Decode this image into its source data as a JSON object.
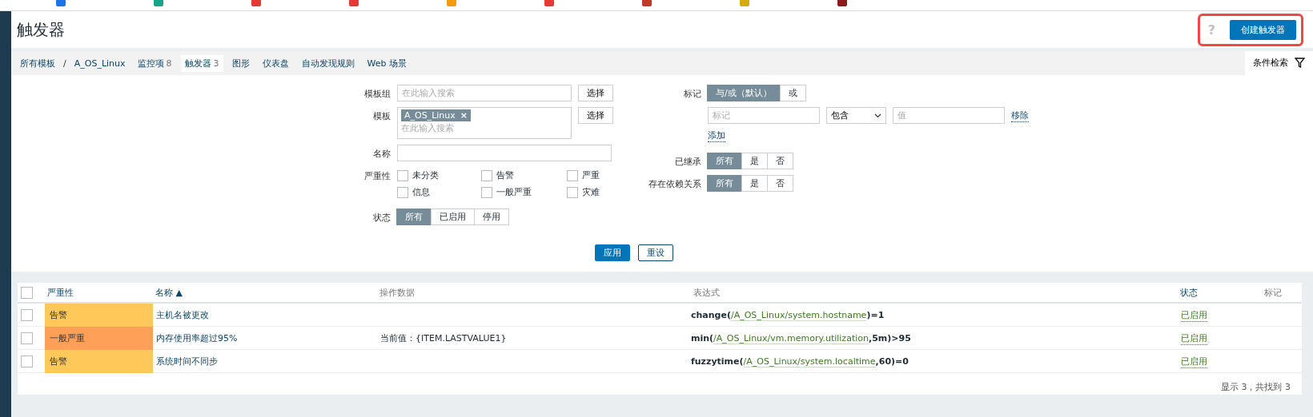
{
  "page_title": "触发器",
  "help": "?",
  "create_button": "创建触发器",
  "breadcrumbs": [
    "所有模板",
    "A_OS_Linux"
  ],
  "breadcrumb_separator": "/",
  "tabs": [
    {
      "label": "监控项",
      "count": "8",
      "selected": false
    },
    {
      "label": "触发器",
      "count": "3",
      "selected": true
    },
    {
      "label": "图形",
      "selected": false
    },
    {
      "label": "仪表盘",
      "selected": false
    },
    {
      "label": "自动发现规则",
      "selected": false
    },
    {
      "label": "Web 场景",
      "selected": false
    }
  ],
  "filter_toggle": "条件检索",
  "filter": {
    "template_group": {
      "label": "模板组",
      "placeholder": "在此输入搜索",
      "button": "选择"
    },
    "template": {
      "label": "模板",
      "chip": "A_OS_Linux",
      "chip_remove": "×",
      "placeholder": "在此输入搜索",
      "button": "选择"
    },
    "name": {
      "label": "名称"
    },
    "severity": {
      "label": "严重性",
      "options": [
        {
          "label": "未分类",
          "checked": false
        },
        {
          "label": "告警",
          "checked": false
        },
        {
          "label": "严重",
          "checked": false
        },
        {
          "label": "信息",
          "checked": false
        },
        {
          "label": "一般严重",
          "checked": false
        },
        {
          "label": "灾难",
          "checked": false
        }
      ]
    },
    "state": {
      "label": "状态",
      "options": [
        {
          "label": "所有",
          "selected": true
        },
        {
          "label": "已启用",
          "selected": false
        },
        {
          "label": "停用",
          "selected": false
        }
      ]
    },
    "tags": {
      "label": "标记",
      "options": [
        {
          "label": "与/或（默认）",
          "selected": true
        },
        {
          "label": "或",
          "selected": false
        }
      ],
      "tag_placeholder": "标记",
      "operator": "包含",
      "value_placeholder": "值",
      "remove": "移除",
      "add": "添加"
    },
    "inherited": {
      "label": "已继承",
      "options": [
        {
          "label": "所有",
          "selected": true
        },
        {
          "label": "是",
          "selected": false
        },
        {
          "label": "否",
          "selected": false
        }
      ]
    },
    "dependencies": {
      "label": "存在依赖关系",
      "options": [
        {
          "label": "所有",
          "selected": true
        },
        {
          "label": "是",
          "selected": false
        },
        {
          "label": "否",
          "selected": false
        }
      ]
    },
    "apply": "应用",
    "reset": "重设"
  },
  "table": {
    "all_checked": false,
    "columns": [
      {
        "label": "严重性",
        "sortable": true
      },
      {
        "label": "名称",
        "sortable": true,
        "sort": "▲"
      },
      {
        "label": "操作数据",
        "sortable": false
      },
      {
        "label": "表达式",
        "sortable": false
      },
      {
        "label": "状态",
        "sortable": true
      },
      {
        "label": "标记",
        "sortable": false
      }
    ],
    "rows": [
      {
        "checked": false,
        "severity": "告警",
        "color": "#ffc859",
        "name": "主机名被更改",
        "operational_data": "",
        "expression": {
          "func": "change(",
          "item": "/A_OS_Linux/system.hostname",
          "rest": ")=1"
        },
        "status": "已启用"
      },
      {
        "checked": false,
        "severity": "一般严重",
        "color": "#ffa059",
        "name": "内存使用率超过95%",
        "operational_data": "当前值：{ITEM.LASTVALUE1}",
        "expression": {
          "func": "min(",
          "item": "/A_OS_Linux/vm.memory.utilization",
          "rest": ",5m)>95"
        },
        "status": "已启用"
      },
      {
        "checked": false,
        "severity": "告警",
        "color": "#ffc859",
        "name": "系统时间不同步",
        "operational_data": "",
        "expression": {
          "func": "fuzzytime(",
          "item": "/A_OS_Linux/system.localtime",
          "rest": ",60)=0"
        },
        "status": "已启用"
      }
    ],
    "footer": "显示 3，共找到 3"
  }
}
